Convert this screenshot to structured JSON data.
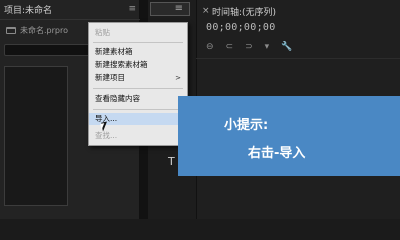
{
  "project_panel": {
    "title": "项目:未命名",
    "menu_icon": "≡",
    "file_name": "未命名.prpro",
    "search_value": ""
  },
  "mid_strip": {
    "menu_icon": "≡",
    "letter": "T"
  },
  "timeline": {
    "close_glyph": "×",
    "title": "时间轴:(无序列)",
    "timecode": "00;00;00;00",
    "tools": [
      "⊖",
      "⊂",
      "⊃",
      "▾",
      "🔧"
    ]
  },
  "context_menu": {
    "items": [
      {
        "label": "粘贴",
        "disabled": true
      },
      {
        "label": "新建素材箱",
        "disabled": false
      },
      {
        "label": "新建搜索素材箱",
        "disabled": false
      },
      {
        "label": "新建项目",
        "disabled": false,
        "submenu": true
      },
      {
        "label": "查看隐藏内容",
        "disabled": false
      },
      {
        "label": "导入...",
        "disabled": false,
        "highlighted": true
      },
      {
        "label": "查找...",
        "disabled": true
      }
    ],
    "submenu_arrow": ">"
  },
  "tip": {
    "title": "小提示:",
    "body": "右击-导入"
  },
  "colors": {
    "tip_background": "#4a88c4",
    "highlight": "#c5d9f1",
    "accent_blue": "#2f6fd1"
  }
}
